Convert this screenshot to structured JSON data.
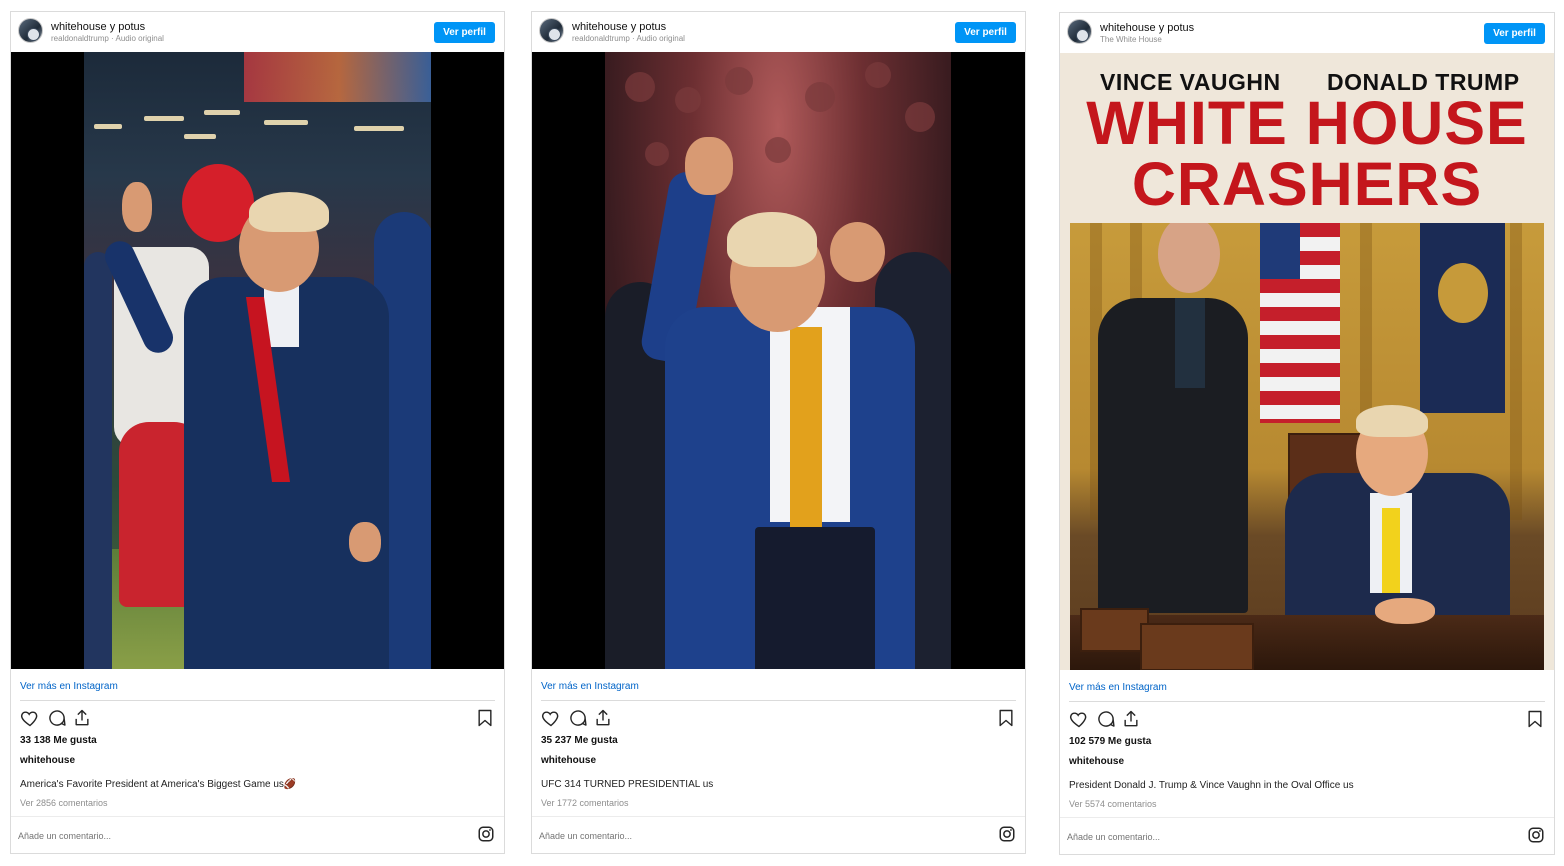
{
  "posts": [
    {
      "username": "whitehouse y potus",
      "subtitle": "realdonaldtrump · Audio original",
      "profile_button": "Ver perfil",
      "more_link": "Ver más en Instagram",
      "likes": "33 138 Me gusta",
      "owner": "whitehouse",
      "caption": "America's Favorite President at America's Biggest Game us🏈",
      "comments": "Ver 2856 comentarios",
      "comment_placeholder": "Añade un comentario..."
    },
    {
      "username": "whitehouse y potus",
      "subtitle": "realdonaldtrump · Audio original",
      "profile_button": "Ver perfil",
      "more_link": "Ver más en Instagram",
      "likes": "35 237 Me gusta",
      "owner": "whitehouse",
      "caption": "UFC 314 TURNED PRESIDENTIAL us",
      "comments": "Ver 1772 comentarios",
      "comment_placeholder": "Añade un comentario..."
    },
    {
      "username": "whitehouse y potus",
      "subtitle": "The White House",
      "profile_button": "Ver perfil",
      "more_link": "Ver más en Instagram",
      "likes": "102 579 Me gusta",
      "owner": "whitehouse",
      "caption": "President Donald J. Trump & Vince Vaughn in the Oval Office us",
      "comments": "Ver 5574 comentarios",
      "comment_placeholder": "Añade un comentario...",
      "poster": {
        "actor_left": "VINCE VAUGHN",
        "actor_right": "DONALD TRUMP",
        "title_line1": "WHITE HOUSE",
        "title_line2": "CRASHERS"
      }
    }
  ],
  "icons": [
    "heart-icon",
    "comment-icon",
    "share-icon",
    "bookmark-icon",
    "instagram-icon"
  ],
  "colors": {
    "button_blue": "#0095f6",
    "link_blue": "#0064c8",
    "poster_red": "#c4161c"
  }
}
